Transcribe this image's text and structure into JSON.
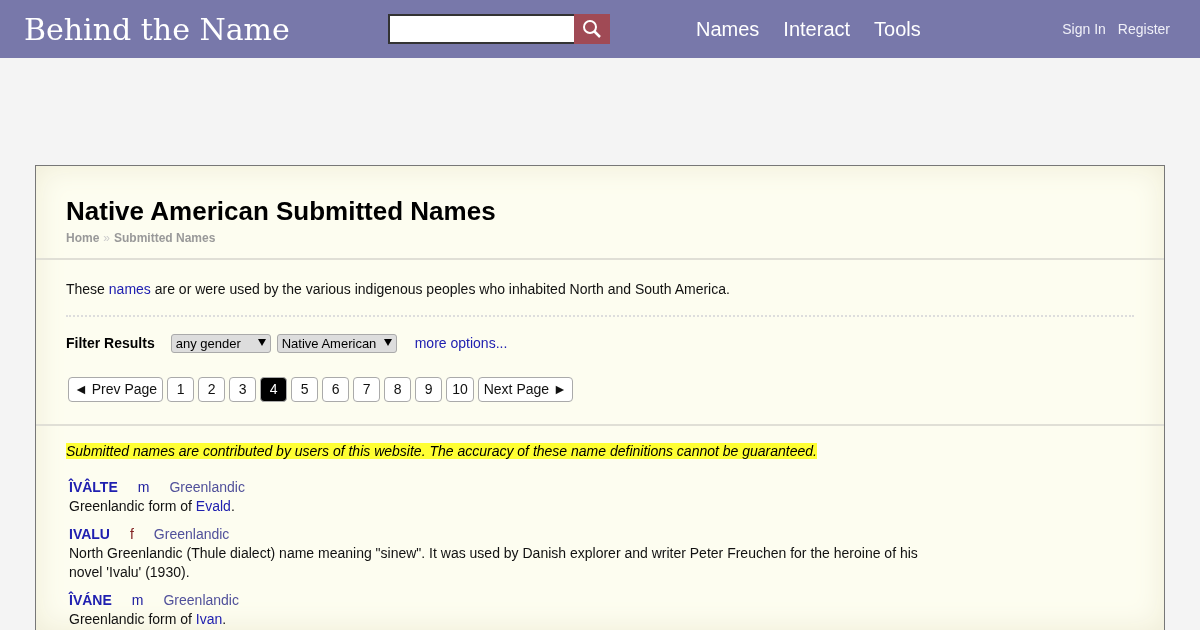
{
  "header": {
    "logo": "Behind the Name",
    "nav": [
      "Names",
      "Interact",
      "Tools"
    ],
    "account": [
      "Sign In",
      "Register"
    ]
  },
  "page": {
    "title": "Native American Submitted Names",
    "breadcrumb": [
      "Home",
      "Submitted Names"
    ],
    "breadcrumb_separator": "»",
    "intro": {
      "before": "These ",
      "link": "names",
      "after": " are or were used by the various indigenous peoples who inhabited North and South America."
    },
    "filter": {
      "label": "Filter Results",
      "selects": [
        "any gender",
        "Native American"
      ],
      "more": "more options..."
    },
    "pagination": {
      "prev": "◄ Prev Page",
      "next": "Next Page ►",
      "pages": [
        {
          "label": "1",
          "selected": false
        },
        {
          "label": "2",
          "selected": false
        },
        {
          "label": "3",
          "selected": false
        },
        {
          "label": "4",
          "selected": true
        },
        {
          "label": "5",
          "selected": false
        },
        {
          "label": "6",
          "selected": false
        },
        {
          "label": "7",
          "selected": false
        },
        {
          "label": "8",
          "selected": false
        },
        {
          "label": "9",
          "selected": false
        },
        {
          "label": "10",
          "selected": false
        }
      ]
    },
    "notice": "Submitted names are contributed by users of this website. The accuracy of these name definitions cannot be guaranteed.",
    "entries": [
      {
        "name": "ÎVÂLTE",
        "gender": "m",
        "kind": "masculine",
        "usage": "Greenlandic",
        "before": "Greenlandic form of ",
        "link": "Evald",
        "after": "."
      },
      {
        "name": "IVALU",
        "gender": "f",
        "kind": "feminine",
        "usage": "Greenlandic",
        "before": "North Greenlandic (Thule dialect) name meaning \"sinew\". It was used by Danish explorer and writer Peter Freuchen for the heroine of his novel 'Ivalu' (1930)."
      },
      {
        "name": "ÎVÁNE",
        "gender": "m",
        "kind": "masculine",
        "usage": "Greenlandic",
        "before": "Greenlandic form of ",
        "link": "Ivan",
        "after": "."
      }
    ]
  }
}
